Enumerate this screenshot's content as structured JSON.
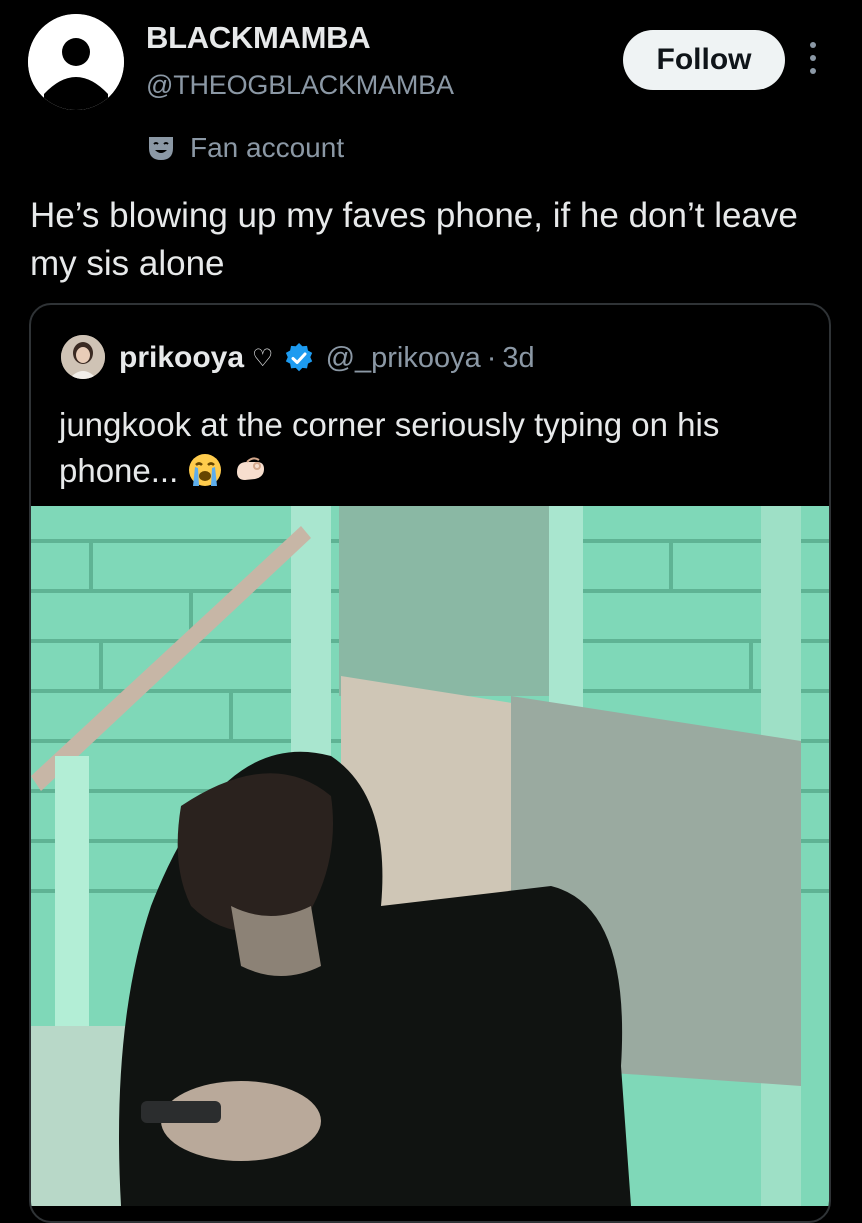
{
  "tweet": {
    "display_name": "BLACKMAMBA",
    "handle": "@THEOGBLACKMAMBA",
    "follow_label": "Follow",
    "label_badge": "Fan account",
    "text": "He’s blowing up my faves phone, if he don’t leave my sis alone"
  },
  "quoted_tweet": {
    "display_name": "prikooya",
    "name_suffix": "♡",
    "handle": "@_prikooya",
    "separator": "·",
    "time": "3d",
    "text": "jungkook at the corner seriously typing on his phone...",
    "emojis": [
      "loudly-crying-face-icon",
      "pinching-hand-icon"
    ],
    "verified_color": "#1d9bf0"
  },
  "icons": {
    "avatar": "default-profile-icon",
    "more": "more-vertical-icon",
    "fan_badge": "theater-mask-icon",
    "verified": "verified-badge-icon"
  }
}
